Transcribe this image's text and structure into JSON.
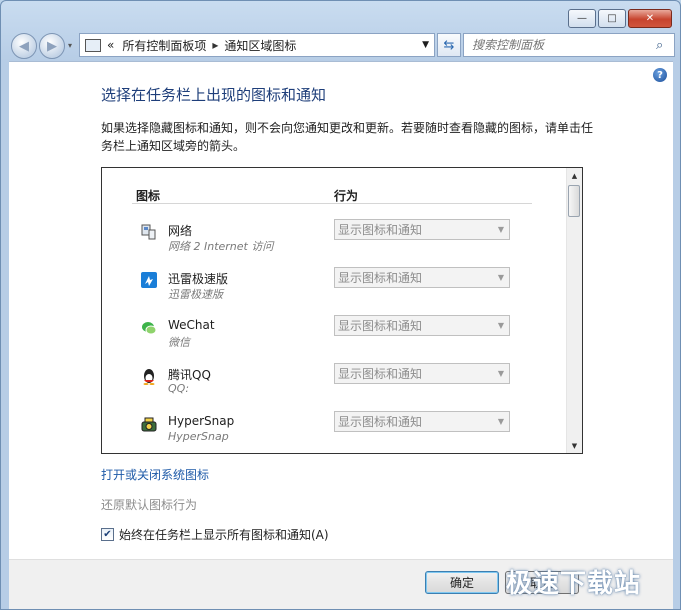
{
  "window": {
    "minimize_glyph": "—",
    "maximize_glyph": "□",
    "close_glyph": "✕"
  },
  "toolbar": {
    "back_glyph": "◀",
    "forward_glyph": "▶",
    "breadcrumb_overflow": "«",
    "breadcrumb_root": "所有控制面板项",
    "breadcrumb_sep": "▸",
    "breadcrumb_current": "通知区域图标",
    "dropdown_glyph": "▼",
    "refresh_glyph": "⇆",
    "search_placeholder": "搜索控制面板",
    "search_glyph": "⌕"
  },
  "main": {
    "help_glyph": "?",
    "title": "选择在任务栏上出现的图标和通知",
    "description": "如果选择隐藏图标和通知，则不会向您通知更改和更新。若要随时查看隐藏的图标，请单击任务栏上通知区域旁的箭头。",
    "column_icon": "图标",
    "column_behavior": "行为",
    "items": [
      {
        "name": "网络",
        "sub": "网络 2 Internet 访问",
        "behavior": "显示图标和通知",
        "icon": "network-icon"
      },
      {
        "name": "迅雷极速版",
        "sub": "迅雷极速版",
        "behavior": "显示图标和通知",
        "icon": "thunder-icon"
      },
      {
        "name": "WeChat",
        "sub": "微信",
        "behavior": "显示图标和通知",
        "icon": "wechat-icon"
      },
      {
        "name": "腾讯QQ",
        "sub": "QQ:",
        "behavior": "显示图标和通知",
        "icon": "qq-icon"
      },
      {
        "name": "HyperSnap",
        "sub": "HyperSnap",
        "behavior": "显示图标和通知",
        "icon": "hypersnap-icon"
      }
    ],
    "link_system_icons": "打开或关闭系统图标",
    "link_restore": "还原默认图标行为",
    "checkbox_label": "始终在任务栏上显示所有图标和通知(A)",
    "checkbox_checked": true
  },
  "footer": {
    "ok_label": "确定",
    "cancel_label": "取消"
  },
  "watermark": "极速下载站"
}
